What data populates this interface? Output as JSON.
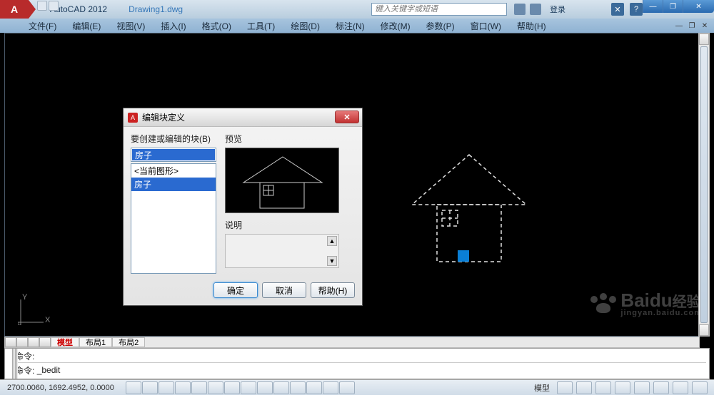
{
  "app": {
    "name": "AutoCAD 2012",
    "document": "Drawing1.dwg",
    "logo_letter": "A"
  },
  "search": {
    "placeholder": "键入关键字或短语"
  },
  "login": {
    "label": "登录"
  },
  "help_icon": "?",
  "window_controls": {
    "min": "—",
    "max": "❐",
    "close": "✕"
  },
  "menus": [
    "文件(F)",
    "编辑(E)",
    "视图(V)",
    "插入(I)",
    "格式(O)",
    "工具(T)",
    "绘图(D)",
    "标注(N)",
    "修改(M)",
    "参数(P)",
    "窗口(W)",
    "帮助(H)"
  ],
  "ucs": {
    "x": "X",
    "y": "Y"
  },
  "layout_tabs": {
    "active": "模型",
    "others": [
      "布局1",
      "布局2"
    ]
  },
  "command": {
    "line1": "命令:",
    "line2_prefix": "命令:",
    "line2_cmd": "_bedit"
  },
  "status": {
    "coords": "2700.0060, 1692.4952, 0.0000",
    "model_label": "模型"
  },
  "dialog": {
    "title": "编辑块定义",
    "block_label": "要创建或编辑的块(B)",
    "selected": "房子",
    "list": [
      "<当前图形>",
      "房子"
    ],
    "preview_label": "预览",
    "desc_label": "说明",
    "ok": "确定",
    "cancel": "取消",
    "help": "帮助(H)",
    "close_glyph": "✕"
  },
  "watermark": {
    "brand": "Baidu",
    "sub_cn": "经验",
    "url": "jingyan.baidu.com"
  }
}
